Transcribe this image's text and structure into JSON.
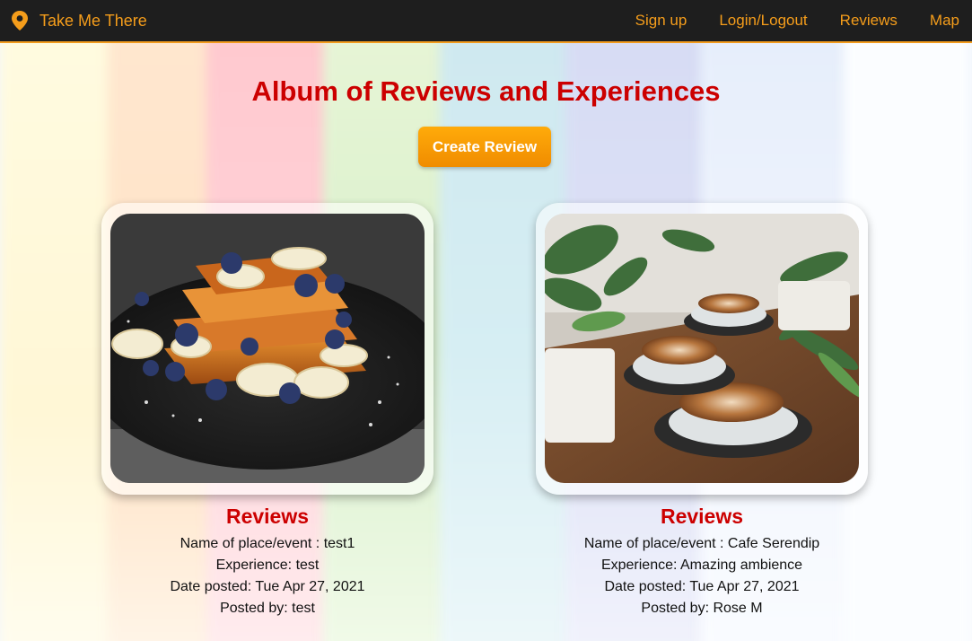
{
  "nav": {
    "brand": "Take Me There",
    "brand_icon": "location-pin-icon",
    "links": [
      "Sign up",
      "Login/Logout",
      "Reviews",
      "Map"
    ],
    "accent": "#f59d1b"
  },
  "page": {
    "title": "Album of Reviews and Experiences",
    "create_button": "Create Review"
  },
  "reviews": [
    {
      "heading": "Reviews",
      "place_label": "Name of place/event : test1",
      "experience_label": "Experience: test",
      "date_label": "Date posted: Tue Apr 27, 2021",
      "author_label": "Posted by: test",
      "image": "french-toast-with-bananas-and-blueberries-photo"
    },
    {
      "heading": "Reviews",
      "place_label": "Name of place/event : Cafe Serendip",
      "experience_label": "Experience: Amazing ambience",
      "date_label": "Date posted: Tue Apr 27, 2021",
      "author_label": "Posted by: Rose M",
      "image": "latte-cups-and-plants-photo"
    }
  ],
  "colors": {
    "title": "#cc0000",
    "button": "#f59d1b",
    "nav_bg": "#1e1e1e"
  }
}
